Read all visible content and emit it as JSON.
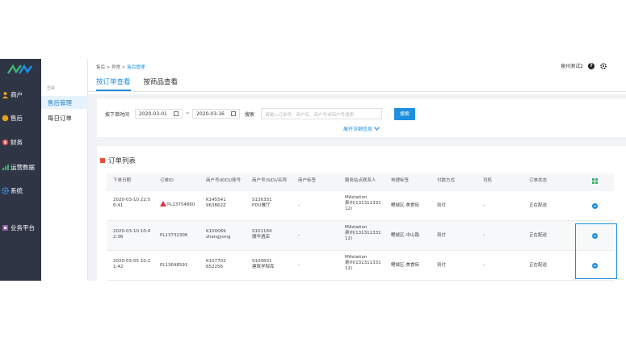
{
  "left_nav": {
    "items": [
      {
        "label": "商户",
        "icon": "user-icon",
        "color": "#e8a317"
      },
      {
        "label": "售后",
        "icon": "coin-icon",
        "color": "#e8a317"
      },
      {
        "label": "财务",
        "icon": "finance-icon",
        "color": "#e04a4a"
      },
      {
        "label": "运营数据",
        "icon": "chart-icon",
        "color": "#3cb371"
      },
      {
        "label": "系统",
        "icon": "gear-icon",
        "color": "#3b8fe0"
      },
      {
        "label": "业务平台",
        "icon": "platform-icon",
        "color": "#9b59b6"
      }
    ]
  },
  "sub_nav": {
    "group_label": "异常",
    "items": [
      {
        "label": "售后管理",
        "active": true
      },
      {
        "label": "每日订单",
        "active": false
      }
    ]
  },
  "breadcrumb": {
    "items": [
      "售后",
      "异常",
      "售后管理"
    ]
  },
  "user": {
    "name": "泉州测试2"
  },
  "tabs": [
    {
      "label": "按订单查看",
      "active": true
    },
    {
      "label": "按商品查看",
      "active": false
    }
  ],
  "filter": {
    "date_label": "按下单时间",
    "start_date": "2020-03-01",
    "separator": "~",
    "end_date": "2020-03-16",
    "search_label": "搜索",
    "search_placeholder": "请输入订单号、商户名、商户号或商户号搜索",
    "search_button": "搜索",
    "expand_label": "展开详细信息"
  },
  "panel_title": "订单列表",
  "table": {
    "columns": [
      "下单日期",
      "订单ID",
      "商户号(KID)/账号",
      "商户号(SID)/名称",
      "商户标签",
      "服务站点联系人",
      "地理标签",
      "付款方式",
      "司机",
      "订单状态"
    ],
    "rows": [
      {
        "date": "2020-03-10 22:5 6:41",
        "order_id": "PL13754860",
        "warning": true,
        "kid": "K145541",
        "account": "963862Z",
        "sid": "S136331",
        "sid_name": "PDU餐厅",
        "tag": "-",
        "station": "MAstation",
        "station_contact": "泉州(131311331 12)",
        "geo": "鲤城区-美食街",
        "payment": "到付",
        "driver": "-",
        "status": "正在配送"
      },
      {
        "date": "2020-03-10 10:4 2:36",
        "order_id": "PL13732306",
        "warning": false,
        "kid": "K100069",
        "account": "zhangyong",
        "sid": "S101184",
        "sid_name": "顺华酒店",
        "tag": "-",
        "station": "MAstation",
        "station_contact": "泉州(131311331 12)",
        "geo": "鲤城区-中山路",
        "payment": "到付",
        "driver": "-",
        "status": "正在配送"
      },
      {
        "date": "2020-03-05 10:2 1:42",
        "order_id": "PL13648591",
        "warning": false,
        "kid": "K107702",
        "account": "852256",
        "sid": "S100601",
        "sid_name": "建筑学院库",
        "tag": "-",
        "station": "MAstation",
        "station_contact": "泉州(131311331 12)",
        "geo": "鲤城区-美食街",
        "payment": "到付",
        "driver": "-",
        "status": "正在配送"
      }
    ]
  },
  "colors": {
    "primary": "#1f8fe0",
    "nav_bg": "#2f3545",
    "warning": "#d9363e"
  }
}
